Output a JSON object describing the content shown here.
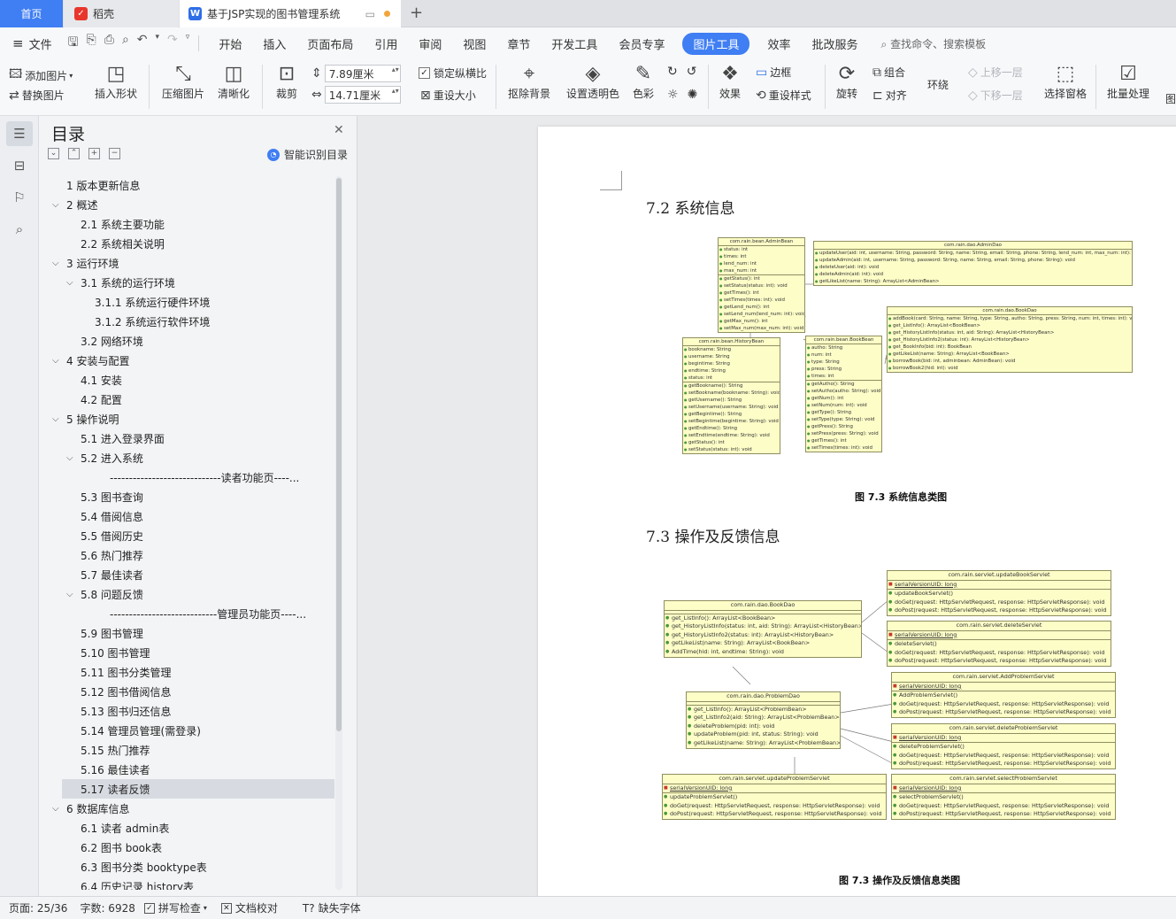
{
  "tabs": [
    {
      "label": "首页"
    },
    {
      "label": "稻壳",
      "icon": "daoke-logo-icon",
      "color": "#e8362c"
    },
    {
      "label": "基于JSP实现的图书管理系统",
      "icon": "wps-writer-icon",
      "color": "#2e6ee6"
    }
  ],
  "menu": {
    "file": "文件",
    "items": [
      "开始",
      "插入",
      "页面布局",
      "引用",
      "审阅",
      "视图",
      "章节",
      "开发工具",
      "会员专享",
      "图片工具",
      "效率",
      "批改服务"
    ],
    "active": "图片工具",
    "search": "查找命令、搜索模板"
  },
  "ribbon": {
    "add_image": "添加图片",
    "replace_image": "替换图片",
    "insert_shape": "插入形状",
    "compress": "压缩图片",
    "sharpen": "清晰化",
    "crop": "裁剪",
    "width": "7.89厘米",
    "height": "14.71厘米",
    "lock_ratio": "锁定纵横比",
    "reset_size": "重设大小",
    "remove_bg": "抠除背景",
    "set_transparent": "设置透明色",
    "color": "色彩",
    "effects": "效果",
    "border": "边框",
    "reset_style": "重设样式",
    "rotate": "旋转",
    "group": "组合",
    "align": "对齐",
    "wrap": "环绕",
    "bring_forward": "上移一层",
    "send_backward": "下移一层",
    "selection_pane": "选择窗格",
    "batch": "批量处理",
    "more": "图"
  },
  "toc": {
    "title": "目录",
    "smart": "智能识别目录",
    "items": [
      {
        "text": "1  版本更新信息",
        "level": 1,
        "exp": ""
      },
      {
        "text": "2  概述",
        "level": 1,
        "exp": "v"
      },
      {
        "text": "2.1  系统主要功能",
        "level": 2,
        "exp": ""
      },
      {
        "text": "2.2  系统相关说明",
        "level": 2,
        "exp": ""
      },
      {
        "text": "3  运行环境",
        "level": 1,
        "exp": "v"
      },
      {
        "text": "3.1  系统的运行环境",
        "level": 2,
        "exp": "v"
      },
      {
        "text": "3.1.1  系统运行硬件环境",
        "level": 3,
        "exp": ""
      },
      {
        "text": "3.1.2  系统运行软件环境",
        "level": 3,
        "exp": ""
      },
      {
        "text": "3.2  网络环境",
        "level": 2,
        "exp": ""
      },
      {
        "text": "4  安装与配置",
        "level": 1,
        "exp": "v"
      },
      {
        "text": "4.1  安装",
        "level": 2,
        "exp": ""
      },
      {
        "text": "4.2  配置",
        "level": 2,
        "exp": ""
      },
      {
        "text": "5  操作说明",
        "level": 1,
        "exp": "v"
      },
      {
        "text": "5.1  进入登录界面",
        "level": 2,
        "exp": ""
      },
      {
        "text": "5.2  进入系统",
        "level": 2,
        "exp": "v"
      },
      {
        "text": "-----------------------------读者功能页----...",
        "level": 4,
        "exp": ""
      },
      {
        "text": "5.3  图书查询",
        "level": 2,
        "exp": ""
      },
      {
        "text": "5.4  借阅信息",
        "level": 2,
        "exp": ""
      },
      {
        "text": "5.5  借阅历史",
        "level": 2,
        "exp": ""
      },
      {
        "text": "5.6  热门推荐",
        "level": 2,
        "exp": ""
      },
      {
        "text": "5.7  最佳读者",
        "level": 2,
        "exp": ""
      },
      {
        "text": "5.8  问题反馈",
        "level": 2,
        "exp": "v"
      },
      {
        "text": "----------------------------管理员功能页----...",
        "level": 4,
        "exp": ""
      },
      {
        "text": "5.9  图书管理",
        "level": 2,
        "exp": ""
      },
      {
        "text": "5.10  图书管理",
        "level": 2,
        "exp": ""
      },
      {
        "text": "5.11  图书分类管理",
        "level": 2,
        "exp": ""
      },
      {
        "text": "5.12  图书借阅信息",
        "level": 2,
        "exp": ""
      },
      {
        "text": "5.13  图书归还信息",
        "level": 2,
        "exp": ""
      },
      {
        "text": "5.14  管理员管理(需登录)",
        "level": 2,
        "exp": ""
      },
      {
        "text": "5.15  热门推荐",
        "level": 2,
        "exp": ""
      },
      {
        "text": "5.16  最佳读者",
        "level": 2,
        "exp": ""
      },
      {
        "text": "5.17  读者反馈",
        "level": 2,
        "exp": "",
        "selected": true
      },
      {
        "text": "6  数据库信息",
        "level": 1,
        "exp": "v"
      },
      {
        "text": "6.1  读者  admin表",
        "level": 2,
        "exp": ""
      },
      {
        "text": "6.2  图书  book表",
        "level": 2,
        "exp": ""
      },
      {
        "text": "6.3  图书分类  booktype表",
        "level": 2,
        "exp": ""
      },
      {
        "text": "6.4  历史记录  history表",
        "level": 2,
        "exp": ""
      }
    ]
  },
  "doc": {
    "h72": "7.2  系统信息",
    "cap1": "图 7.3 系统信息类图",
    "h73": "7.3  操作及反馈信息",
    "cap2": "图 7.3 操作及反馈信息类图",
    "diagram1": [
      {
        "title": "com.rain.bean.AdminBean",
        "sections": [
          [
            "status: int",
            "times: int",
            "lend_num: int",
            "max_num: int"
          ],
          [
            "getStatus(): int",
            "setStatus(status: int): void",
            "getTimes(): int",
            "setTimes(times: int): void",
            "getLend_num(): int",
            "setLend_num(lend_num: int): void",
            "getMax_num(): int",
            "setMax_num(max_num: int): void"
          ]
        ]
      },
      {
        "title": "com.rain.dao.AdminDao",
        "sections": [
          [
            "updateUser(aid: int, username: String, password: String, name: String, email: String, phone: String, lend_num: int, max_num: int): void",
            "updateAdmin(aid: int, username: String, password: String, name: String, email: String, phone: String): void",
            "deleteUser(aid: int): void",
            "deleteAdmin(aid: int): void",
            "getLikeList(name: String): ArrayList<AdminBean>"
          ]
        ]
      },
      {
        "title": "com.rain.dao.BookDao",
        "sections": [
          [
            "addBook(card: String, name: String, type: String, autho: String, press: String, num: int, times: int): void",
            "get_ListInfo(): ArrayList<BookBean>",
            "get_HistoryListInfo(status: int, aid: String): ArrayList<HistoryBean>",
            "get_HistoryListInfo2(status: int): ArrayList<HistoryBean>",
            "get_BookInfo(bid: int): BookBean",
            "getLikeList(name: String): ArrayList<BookBean>",
            "borrowBook(bid: int, adminbean: AdminBean): void",
            "borrowBook2(hid: int): void"
          ]
        ]
      },
      {
        "title": "com.rain.bean.HistoryBean",
        "sections": [
          [
            "bookname: String",
            "username: String",
            "begintime: String",
            "endtime: String",
            "status: int"
          ],
          [
            "getBookname(): String",
            "setBookname(bookname: String): void",
            "getUsername(): String",
            "setUsername(username: String): void",
            "getBegintime(): String",
            "setBegintime(begintime: String): void",
            "getEndtime(): String",
            "setEndtime(endtime: String): void",
            "getStatus(): int",
            "setStatus(status: int): void"
          ]
        ]
      },
      {
        "title": "com.rain.bean.BookBean",
        "sections": [
          [
            "autho: String",
            "num: int",
            "type: String",
            "press: String",
            "times: int"
          ],
          [
            "getAutho(): String",
            "setAutho(autho: String): void",
            "getNum(): int",
            "setNum(num: int): void",
            "getType(): String",
            "setType(type: String): void",
            "getPress(): String",
            "setPress(press: String): void",
            "getTimes(): int",
            "setTimes(times: int): void"
          ]
        ]
      }
    ],
    "diagram2": [
      {
        "title": "com.rain.servlet.updateBookServlet",
        "sections": [
          [
            "serialVersionUID: long"
          ],
          [
            "updateBookServlet()",
            "doGet(request: HttpServletRequest, response: HttpServletResponse): void",
            "doPost(request: HttpServletRequest, response: HttpServletResponse): void"
          ]
        ]
      },
      {
        "title": "com.rain.dao.BookDao",
        "sections": [
          [],
          [
            "get_ListInfo(): ArrayList<BookBean>",
            "get_HistoryListInfo(status: int, aid: String): ArrayList<HistoryBean>",
            "get_HistoryListInfo2(status: int): ArrayList<HistoryBean>",
            "getLikeList(name: String): ArrayList<BookBean>",
            "AddTime(hid: int, endtime: String): void"
          ]
        ]
      },
      {
        "title": "com.rain.servlet.deleteServlet",
        "sections": [
          [
            "serialVersionUID: long"
          ],
          [
            "deleteServlet()",
            "doGet(request: HttpServletRequest, response: HttpServletResponse): void",
            "doPost(request: HttpServletRequest, response: HttpServletResponse): void"
          ]
        ]
      },
      {
        "title": "com.rain.servlet.AddProblemServlet",
        "sections": [
          [
            "serialVersionUID: long"
          ],
          [
            "AddProblemServlet()",
            "doGet(request: HttpServletRequest, response: HttpServletResponse): void",
            "doPost(request: HttpServletRequest, response: HttpServletResponse): void"
          ]
        ]
      },
      {
        "title": "com.rain.dao.ProblemDao",
        "sections": [
          [],
          [
            "get_ListInfo(): ArrayList<ProblemBean>",
            "get_ListInfo2(aid: String): ArrayList<ProblemBean>",
            "deleteProblem(pid: int): void",
            "updateProblem(pid: int, status: String): void",
            "getLikeList(name: String): ArrayList<ProblemBean>"
          ]
        ]
      },
      {
        "title": "com.rain.servlet.deleteProblemServlet",
        "sections": [
          [
            "serialVersionUID: long"
          ],
          [
            "deleteProblemServlet()",
            "doGet(request: HttpServletRequest, response: HttpServletResponse): void",
            "doPost(request: HttpServletRequest, response: HttpServletResponse): void"
          ]
        ]
      },
      {
        "title": "com.rain.servlet.updateProblemServlet",
        "sections": [
          [
            "serialVersionUID: long"
          ],
          [
            "updateProblemServlet()",
            "doGet(request: HttpServletRequest, response: HttpServletResponse): void",
            "doPost(request: HttpServletRequest, response: HttpServletResponse): void"
          ]
        ]
      },
      {
        "title": "com.rain.servlet.selectProblemServlet",
        "sections": [
          [
            "serialVersionUID: long"
          ],
          [
            "selectProblemServlet()",
            "doGet(request: HttpServletRequest, response: HttpServletResponse): void",
            "doPost(request: HttpServletRequest, response: HttpServletResponse): void"
          ]
        ]
      }
    ]
  },
  "status": {
    "page": "页面: 25/36",
    "words": "字数: 6928",
    "spell": "拼写检查",
    "proof": "文档校对",
    "missing_font": "缺失字体"
  }
}
